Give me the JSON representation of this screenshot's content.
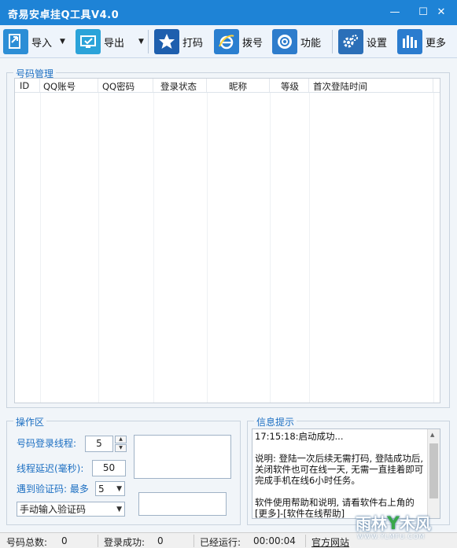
{
  "window": {
    "title": "奇易安卓挂Q工具V4.0",
    "min_glyph": "—",
    "max_glyph": "☐",
    "close_glyph": "✕"
  },
  "toolbar": {
    "import": "导入",
    "export": "导出",
    "dial_code": "打码",
    "dialup": "拨号",
    "functions": "功能",
    "settings": "设置",
    "more": "更多",
    "drop_glyph": "▼"
  },
  "number_mgmt": {
    "title": "号码管理",
    "columns": [
      "ID",
      "QQ账号",
      "QQ密码",
      "登录状态",
      "昵称",
      "等级",
      "首次登陆时间"
    ]
  },
  "operations": {
    "title": "操作区",
    "login_threads_label": "号码登录线程:",
    "login_threads_value": "5",
    "delay_label": "线程延迟(毫秒):",
    "delay_value": "50",
    "captcha_label": "遇到验证码: 最多",
    "captcha_max": "5",
    "captcha_mode": "手动输入验证码"
  },
  "info_panel": {
    "title": "信息提示",
    "lines": [
      "17:15:18:启动成功...",
      "说明: 登陆一次后续无需打码, 登陆成功后, 关闭软件也可在线一天, 无需一直挂着即可完成手机在线6小时任务。",
      "软件使用帮助和说明, 请看软件右上角的[更多]-[软件在线帮助]"
    ]
  },
  "statusbar": {
    "total_label": "号码总数:",
    "total_value": "0",
    "success_label": "登录成功:",
    "success_value": "0",
    "running_label": "已经运行:",
    "running_value": "00:00:04",
    "site_label": "官方网站"
  },
  "watermark": {
    "text_a": "雨林",
    "text_b": "木风",
    "url": "WWW.YLMFU.COM"
  },
  "colors": {
    "titlebar": "#1e83d6",
    "accent_text": "#1c6fc2"
  }
}
